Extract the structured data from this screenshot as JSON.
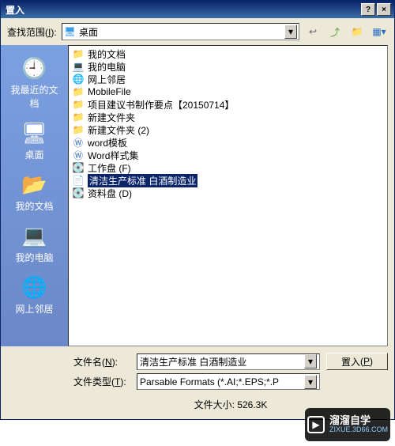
{
  "title": "置入",
  "toolbar": {
    "look_in_label": "查找范围",
    "look_in_key": "I",
    "location": "桌面"
  },
  "sidebar": {
    "items": [
      {
        "label": "我最近的文档",
        "icon": "recent"
      },
      {
        "label": "桌面",
        "icon": "desktop"
      },
      {
        "label": "我的文档",
        "icon": "mydocs"
      },
      {
        "label": "我的电脑",
        "icon": "computer"
      },
      {
        "label": "网上邻居",
        "icon": "network"
      }
    ]
  },
  "files": {
    "items": [
      {
        "name": "我的文档",
        "icon": "folder-docs",
        "selected": false
      },
      {
        "name": "我的电脑",
        "icon": "computer",
        "selected": false
      },
      {
        "name": "网上邻居",
        "icon": "network",
        "selected": false
      },
      {
        "name": "MobileFile",
        "icon": "folder",
        "selected": false
      },
      {
        "name": "项目建议书制作要点【20150714】",
        "icon": "folder",
        "selected": false
      },
      {
        "name": "新建文件夹",
        "icon": "folder",
        "selected": false
      },
      {
        "name": "新建文件夹 (2)",
        "icon": "folder",
        "selected": false
      },
      {
        "name": "word模板",
        "icon": "word",
        "selected": false
      },
      {
        "name": "Word样式集",
        "icon": "word",
        "selected": false
      },
      {
        "name": "工作盘 (F)",
        "icon": "drive",
        "selected": false
      },
      {
        "name": "清洁生产标准 白酒制造业",
        "icon": "doc",
        "selected": true
      },
      {
        "name": "资料盘 (D)",
        "icon": "drive",
        "selected": false
      }
    ]
  },
  "bottom": {
    "filename_label": "文件名",
    "filename_key": "N",
    "filename_value": "清洁生产标准 白酒制造业",
    "filetype_label": "文件类型",
    "filetype_key": "T",
    "filetype_value": "Parsable Formats (*.AI;*.EPS;*.P",
    "open_label": "置入",
    "open_key": "P",
    "size_label": "文件大小:",
    "size_value": "526.3K"
  },
  "watermark": {
    "line1": "溜溜自学",
    "line2": "ZIXUE.3D66.COM"
  }
}
